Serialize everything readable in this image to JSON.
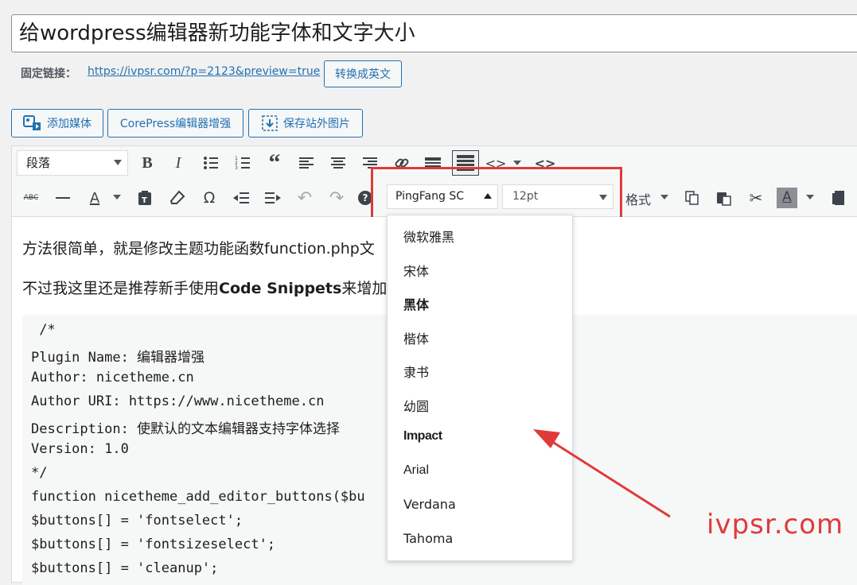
{
  "post": {
    "title": "给wordpress编辑器新功能字体和文字大小",
    "permalink_label": "固定链接：",
    "permalink_url": "https://ivpsr.com/?p=2123&preview=true",
    "convert_button": "转换成英文"
  },
  "media_buttons": {
    "add_media": "添加媒体",
    "corepress": "CorePress编辑器增强",
    "save_images": "保存站外图片"
  },
  "toolbar": {
    "format_select": "段落",
    "font_family": "PingFang SC",
    "font_size": "12pt",
    "styles_menu": "格式",
    "strike_label": "ABC",
    "text_color_label": "A"
  },
  "font_menu": {
    "items": [
      "微软雅黑",
      "宋体",
      "黑体",
      "楷体",
      "隶书",
      "幼圆",
      "Impact",
      "Arial",
      "Verdana",
      "Tahoma"
    ]
  },
  "content": {
    "para1": "方法很简单，就是修改主题功能函数function.php文",
    "para2_prefix": "不过我这里还是推荐新手使用",
    "para2_bold": "Code Snippets",
    "para2_suffix": "来增加",
    "code_lines": [
      " /*",
      "Plugin Name: 编辑器增强",
      "Author: nicetheme.cn",
      "Author URI: https://www.nicetheme.cn",
      "Description: 使默认的文本编辑器支持字体选择",
      "Version: 1.0",
      "*/",
      "function nicetheme_add_editor_buttons($bu",
      "$buttons[] = 'fontselect';",
      "$buttons[] = 'fontsizeselect';",
      "$buttons[] = 'cleanup';"
    ]
  },
  "watermark": "ivpsr.com",
  "colors": {
    "accent": "#2271b1",
    "highlight_red": "#e03a3a"
  }
}
